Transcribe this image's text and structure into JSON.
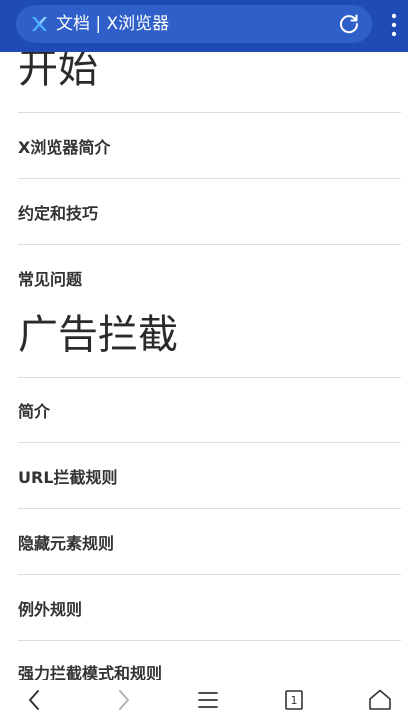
{
  "browser": {
    "title": "文档 | X浏览器",
    "site_icon": "x-browser-logo-icon",
    "accent_color": "#1e4bb5",
    "tab_count": "1"
  },
  "sections": [
    {
      "heading": "开始",
      "items": [
        "X浏览器简介",
        "约定和技巧",
        "常见问题"
      ]
    },
    {
      "heading": "广告拦截",
      "items": [
        "简介",
        "URL拦截规则",
        "隐藏元素规则",
        "例外规则",
        "强力拦截模式和规则"
      ]
    }
  ],
  "navbar": {
    "icons": [
      "back-icon",
      "forward-icon",
      "menu-icon",
      "tabs-icon",
      "home-icon"
    ]
  }
}
